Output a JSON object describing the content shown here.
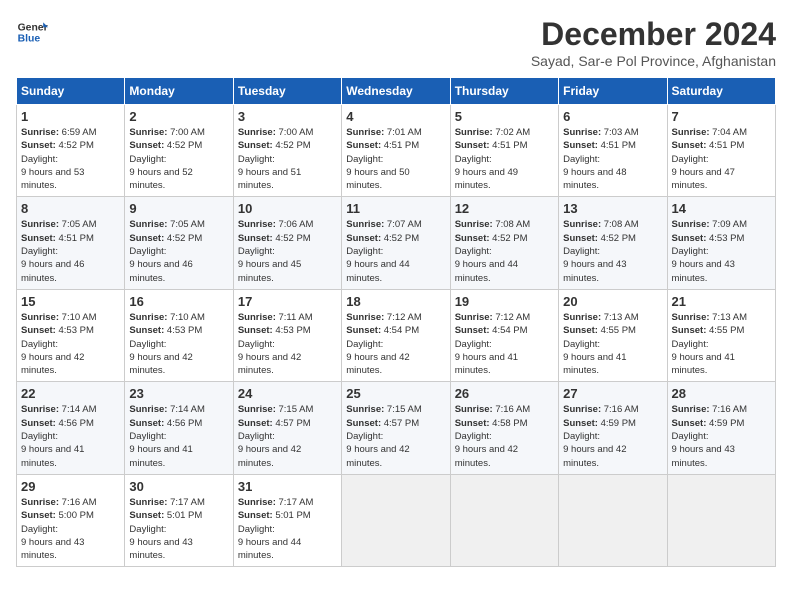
{
  "logo": {
    "line1": "General",
    "line2": "Blue"
  },
  "title": "December 2024",
  "subtitle": "Sayad, Sar-e Pol Province, Afghanistan",
  "weekdays": [
    "Sunday",
    "Monday",
    "Tuesday",
    "Wednesday",
    "Thursday",
    "Friday",
    "Saturday"
  ],
  "weeks": [
    [
      {
        "day": "1",
        "sunrise": "6:59 AM",
        "sunset": "4:52 PM",
        "daylight": "9 hours and 53 minutes."
      },
      {
        "day": "2",
        "sunrise": "7:00 AM",
        "sunset": "4:52 PM",
        "daylight": "9 hours and 52 minutes."
      },
      {
        "day": "3",
        "sunrise": "7:00 AM",
        "sunset": "4:52 PM",
        "daylight": "9 hours and 51 minutes."
      },
      {
        "day": "4",
        "sunrise": "7:01 AM",
        "sunset": "4:51 PM",
        "daylight": "9 hours and 50 minutes."
      },
      {
        "day": "5",
        "sunrise": "7:02 AM",
        "sunset": "4:51 PM",
        "daylight": "9 hours and 49 minutes."
      },
      {
        "day": "6",
        "sunrise": "7:03 AM",
        "sunset": "4:51 PM",
        "daylight": "9 hours and 48 minutes."
      },
      {
        "day": "7",
        "sunrise": "7:04 AM",
        "sunset": "4:51 PM",
        "daylight": "9 hours and 47 minutes."
      }
    ],
    [
      {
        "day": "8",
        "sunrise": "7:05 AM",
        "sunset": "4:51 PM",
        "daylight": "9 hours and 46 minutes."
      },
      {
        "day": "9",
        "sunrise": "7:05 AM",
        "sunset": "4:52 PM",
        "daylight": "9 hours and 46 minutes."
      },
      {
        "day": "10",
        "sunrise": "7:06 AM",
        "sunset": "4:52 PM",
        "daylight": "9 hours and 45 minutes."
      },
      {
        "day": "11",
        "sunrise": "7:07 AM",
        "sunset": "4:52 PM",
        "daylight": "9 hours and 44 minutes."
      },
      {
        "day": "12",
        "sunrise": "7:08 AM",
        "sunset": "4:52 PM",
        "daylight": "9 hours and 44 minutes."
      },
      {
        "day": "13",
        "sunrise": "7:08 AM",
        "sunset": "4:52 PM",
        "daylight": "9 hours and 43 minutes."
      },
      {
        "day": "14",
        "sunrise": "7:09 AM",
        "sunset": "4:53 PM",
        "daylight": "9 hours and 43 minutes."
      }
    ],
    [
      {
        "day": "15",
        "sunrise": "7:10 AM",
        "sunset": "4:53 PM",
        "daylight": "9 hours and 42 minutes."
      },
      {
        "day": "16",
        "sunrise": "7:10 AM",
        "sunset": "4:53 PM",
        "daylight": "9 hours and 42 minutes."
      },
      {
        "day": "17",
        "sunrise": "7:11 AM",
        "sunset": "4:53 PM",
        "daylight": "9 hours and 42 minutes."
      },
      {
        "day": "18",
        "sunrise": "7:12 AM",
        "sunset": "4:54 PM",
        "daylight": "9 hours and 42 minutes."
      },
      {
        "day": "19",
        "sunrise": "7:12 AM",
        "sunset": "4:54 PM",
        "daylight": "9 hours and 41 minutes."
      },
      {
        "day": "20",
        "sunrise": "7:13 AM",
        "sunset": "4:55 PM",
        "daylight": "9 hours and 41 minutes."
      },
      {
        "day": "21",
        "sunrise": "7:13 AM",
        "sunset": "4:55 PM",
        "daylight": "9 hours and 41 minutes."
      }
    ],
    [
      {
        "day": "22",
        "sunrise": "7:14 AM",
        "sunset": "4:56 PM",
        "daylight": "9 hours and 41 minutes."
      },
      {
        "day": "23",
        "sunrise": "7:14 AM",
        "sunset": "4:56 PM",
        "daylight": "9 hours and 41 minutes."
      },
      {
        "day": "24",
        "sunrise": "7:15 AM",
        "sunset": "4:57 PM",
        "daylight": "9 hours and 42 minutes."
      },
      {
        "day": "25",
        "sunrise": "7:15 AM",
        "sunset": "4:57 PM",
        "daylight": "9 hours and 42 minutes."
      },
      {
        "day": "26",
        "sunrise": "7:16 AM",
        "sunset": "4:58 PM",
        "daylight": "9 hours and 42 minutes."
      },
      {
        "day": "27",
        "sunrise": "7:16 AM",
        "sunset": "4:59 PM",
        "daylight": "9 hours and 42 minutes."
      },
      {
        "day": "28",
        "sunrise": "7:16 AM",
        "sunset": "4:59 PM",
        "daylight": "9 hours and 43 minutes."
      }
    ],
    [
      {
        "day": "29",
        "sunrise": "7:16 AM",
        "sunset": "5:00 PM",
        "daylight": "9 hours and 43 minutes."
      },
      {
        "day": "30",
        "sunrise": "7:17 AM",
        "sunset": "5:01 PM",
        "daylight": "9 hours and 43 minutes."
      },
      {
        "day": "31",
        "sunrise": "7:17 AM",
        "sunset": "5:01 PM",
        "daylight": "9 hours and 44 minutes."
      },
      null,
      null,
      null,
      null
    ]
  ],
  "labels": {
    "sunrise": "Sunrise:",
    "sunset": "Sunset:",
    "daylight": "Daylight:"
  }
}
